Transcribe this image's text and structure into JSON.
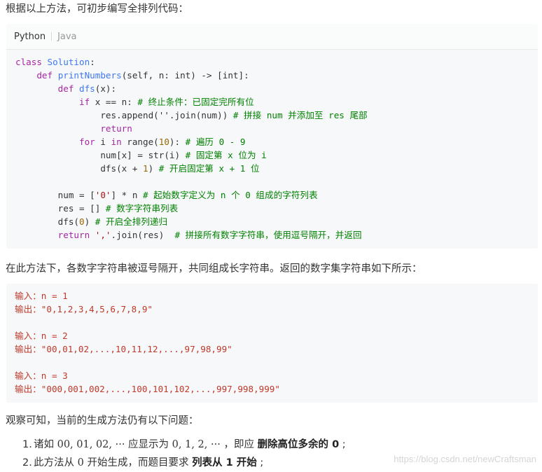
{
  "intro": "根据以上方法，可初步编写全排列代码：",
  "tabs": [
    "Python",
    "Java"
  ],
  "code_lines": [
    {
      "indent": 0,
      "parts": [
        [
          "kw",
          "class"
        ],
        [
          "t",
          " "
        ],
        [
          "fn",
          "Solution"
        ],
        [
          "t",
          ":"
        ]
      ]
    },
    {
      "indent": 1,
      "parts": [
        [
          "kw",
          "def"
        ],
        [
          "t",
          " "
        ],
        [
          "fn",
          "printNumbers"
        ],
        [
          "t",
          "(self, n: int) -> [int]:"
        ]
      ]
    },
    {
      "indent": 2,
      "parts": [
        [
          "kw",
          "def"
        ],
        [
          "t",
          " "
        ],
        [
          "fn",
          "dfs"
        ],
        [
          "t",
          "(x):"
        ]
      ]
    },
    {
      "indent": 3,
      "parts": [
        [
          "kw",
          "if"
        ],
        [
          "t",
          " x == n: "
        ],
        [
          "cm",
          "# 终止条件：已固定完所有位"
        ]
      ]
    },
    {
      "indent": 4,
      "parts": [
        [
          "t",
          "res.append(''.join(num)) "
        ],
        [
          "cm",
          "# 拼接 num 并添加至 res 尾部"
        ]
      ]
    },
    {
      "indent": 4,
      "parts": [
        [
          "kw",
          "return"
        ]
      ]
    },
    {
      "indent": 3,
      "parts": [
        [
          "kw",
          "for"
        ],
        [
          "t",
          " i "
        ],
        [
          "kw",
          "in"
        ],
        [
          "t",
          " range("
        ],
        [
          "nm",
          "10"
        ],
        [
          "t",
          "): "
        ],
        [
          "cm",
          "# 遍历 0 - 9"
        ]
      ]
    },
    {
      "indent": 4,
      "parts": [
        [
          "t",
          "num[x] = str(i) "
        ],
        [
          "cm",
          "# 固定第 x 位为 i"
        ]
      ]
    },
    {
      "indent": 4,
      "parts": [
        [
          "t",
          "dfs(x + "
        ],
        [
          "nm",
          "1"
        ],
        [
          "t",
          ") "
        ],
        [
          "cm",
          "# 开启固定第 x + 1 位"
        ]
      ]
    },
    {
      "indent": 0,
      "parts": [
        [
          "t",
          ""
        ]
      ]
    },
    {
      "indent": 2,
      "parts": [
        [
          "t",
          "num = ["
        ],
        [
          "st",
          "'0'"
        ],
        [
          "t",
          "] * n "
        ],
        [
          "cm",
          "# 起始数字定义为 n 个 0 组成的字符列表"
        ]
      ]
    },
    {
      "indent": 2,
      "parts": [
        [
          "t",
          "res = [] "
        ],
        [
          "cm",
          "# 数字字符串列表"
        ]
      ]
    },
    {
      "indent": 2,
      "parts": [
        [
          "t",
          "dfs("
        ],
        [
          "nm",
          "0"
        ],
        [
          "t",
          ") "
        ],
        [
          "cm",
          "# 开启全排列递归"
        ]
      ]
    },
    {
      "indent": 2,
      "parts": [
        [
          "kw",
          "return"
        ],
        [
          "t",
          " "
        ],
        [
          "st",
          "','"
        ],
        [
          "t",
          ".join(res)  "
        ],
        [
          "cm",
          "# 拼接所有数字字符串，使用逗号隔开，并返回"
        ]
      ]
    }
  ],
  "desc": "在此方法下，各数字字符串被逗号隔开，共同组成长字符串。返回的数字集字符串如下所示：",
  "output_lines": [
    "输入：n = 1",
    "输出：\"0,1,2,3,4,5,6,7,8,9\"",
    "",
    "输入：n = 2",
    "输出：\"00,01,02,...,10,11,12,...,97,98,99\"",
    "",
    "输入：n = 3",
    "输出：\"000,001,002,...,100,101,102,...,997,998,999\""
  ],
  "observe": "观察可知，当前的生成方法仍有以下问题：",
  "issues": [
    {
      "n": "1.",
      "a": "诸如 ",
      "m1": "00, 01, 02, ···",
      "b": " 应显示为 ",
      "m2": "0, 1, 2, ···",
      "c": " ，即应 ",
      "bold": "删除高位多余的 0",
      "d": " ;"
    },
    {
      "n": "2.",
      "a": "此方法从 ",
      "m1": "0",
      "b": " 开始生成，而题目要求 ",
      "bold": "列表从 1 开始",
      "d": " ;"
    }
  ],
  "watermark": "https://blog.csdn.net/newCraftsman"
}
